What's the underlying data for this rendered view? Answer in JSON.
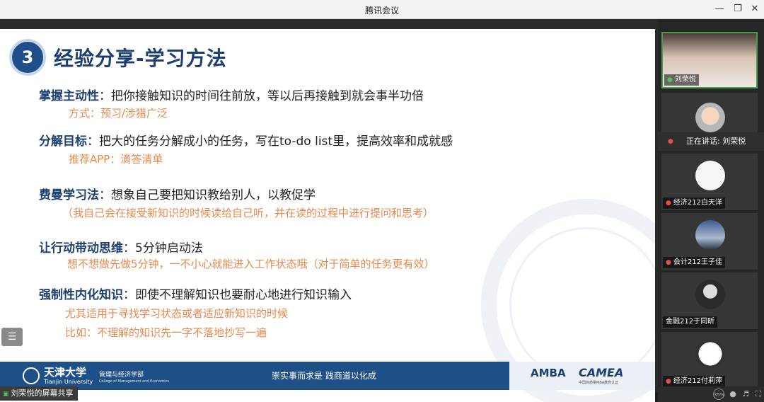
{
  "window": {
    "title": "腾讯会议",
    "minimize_icon": "minimize-icon",
    "restore_icon": "restore-icon",
    "close_icon": "close-icon"
  },
  "slide": {
    "number": "3",
    "title": "经验分享-学习方法",
    "items": [
      {
        "key": "掌握主动性",
        "text": "：把你接触知识的时间往前放，等以后再接触到就会事半功倍",
        "sub": [
          "方式：预习/涉猎广泛"
        ]
      },
      {
        "key": "分解目标",
        "text": "：把大的任务分解成小的任务，写在to-do list里，提高效率和成就感",
        "sub": [
          "推荐APP：滴答清单"
        ]
      },
      {
        "key": "费曼学习法",
        "text": "：想象自己要把知识教给别人，以教促学",
        "sub": [
          "（我自己会在接受新知识的时候读给自己听，并在读的过程中进行提问和思考）"
        ]
      },
      {
        "key": "让行动带动思维",
        "text": "：5分钟启动法",
        "sub": [
          "想不想做先做5分钟，一不小心就能进入工作状态哦（对于简单的任务更有效）"
        ]
      },
      {
        "key": "强制性内化知识",
        "text": "：即使不理解知识也要耐心地进行知识输入",
        "sub": [
          "尤其适用于寻找学习状态或者适应新知识的时候",
          "比如：不理解的知识先一字不落地抄写一遍"
        ]
      }
    ],
    "footer": {
      "university_cn": "天津大学",
      "university_en": "Tianjin University",
      "dept_cn": "管理与经济学部",
      "dept_en": "College of Management and Economics",
      "motto": "崇实事而求是   践商道以化成",
      "amba": "AMBA",
      "camea": "CAMEA",
      "camea_sub": "中国高质量MBA教育认证"
    }
  },
  "share_label": "刘荣悦的屏幕共享",
  "speaking_label": "正在讲话: 刘荣悦",
  "participants": [
    {
      "name": "刘荣悦",
      "mic": "on"
    },
    {
      "name": "经济212白天洋",
      "mic": "off"
    },
    {
      "name": "会计212王子佳",
      "mic": "off"
    },
    {
      "name": "金融212于同昕",
      "mic": "none"
    },
    {
      "name": "经济212付莉萍",
      "mic": "off"
    }
  ],
  "bottom_bar": {
    "badge": "35%"
  }
}
